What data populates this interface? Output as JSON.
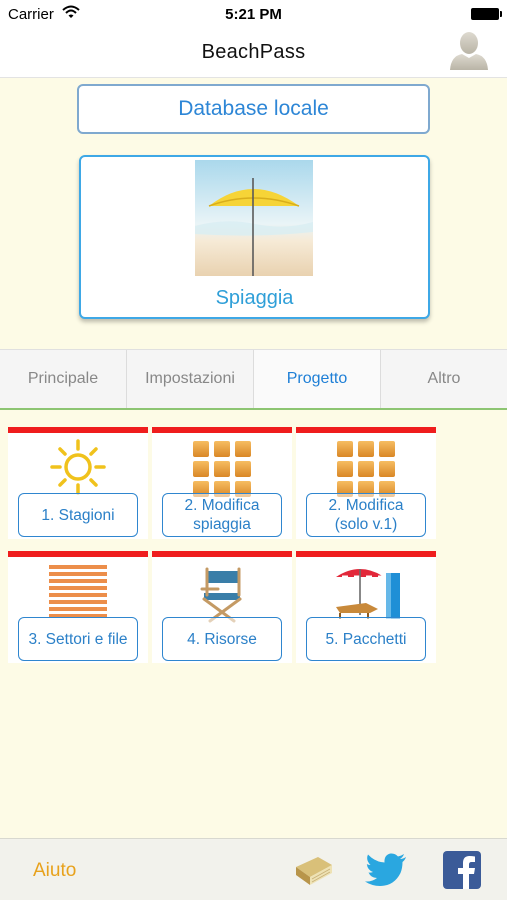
{
  "status_bar": {
    "carrier": "Carrier",
    "time": "5:21 PM"
  },
  "nav": {
    "title": "BeachPass",
    "profile_icon": "user-silhouette-icon"
  },
  "database_button": {
    "label": "Database locale"
  },
  "beach_card": {
    "label": "Spiaggia",
    "image": "beach-umbrella-image"
  },
  "tabs": [
    {
      "label": "Principale",
      "active": false
    },
    {
      "label": "Impostazioni",
      "active": false
    },
    {
      "label": "Progetto",
      "active": true
    },
    {
      "label": "Altro",
      "active": false
    }
  ],
  "tiles": [
    {
      "label": "1. Stagioni",
      "icon": "sun-icon"
    },
    {
      "label": "2. Modifica spiaggia",
      "icon": "grid-icon"
    },
    {
      "label": "2. Modifica (solo v.1)",
      "icon": "grid-icon"
    },
    {
      "label": "3. Settori e file",
      "icon": "striped-blind-icon"
    },
    {
      "label": "4. Risorse",
      "icon": "director-chair-icon"
    },
    {
      "label": "5. Pacchetti",
      "icon": "umbrella-lounger-icon"
    }
  ],
  "colors": {
    "accent": "#2b80c8",
    "tile_bar": "#ef1d1d",
    "help": "#e8a21c",
    "tab_underline": "#8dc572",
    "background": "#fdfbe6"
  },
  "bottom_bar": {
    "help_label": "Aiuto",
    "icons": [
      "book-icon",
      "twitter-icon",
      "facebook-icon"
    ]
  }
}
